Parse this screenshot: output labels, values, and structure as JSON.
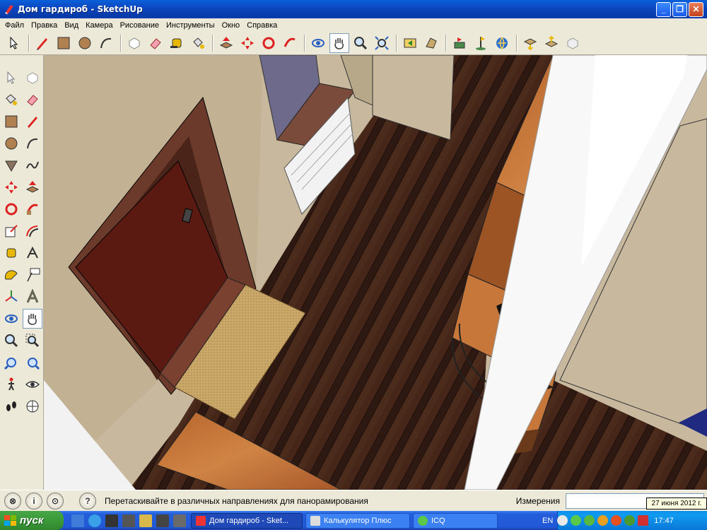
{
  "window": {
    "title": "Дом гардироб - SketchUp",
    "min_label": "_",
    "max_label": "❐",
    "close_label": "✕"
  },
  "menu": [
    "Файл",
    "Правка",
    "Вид",
    "Камера",
    "Рисование",
    "Инструменты",
    "Окно",
    "Справка"
  ],
  "toolbar_icons": [
    "select-icon",
    "pencil-icon",
    "rectangle-icon",
    "circle-icon",
    "arc-icon",
    "make-component-icon",
    "eraser-icon",
    "tape-measure-icon",
    "paint-bucket-icon",
    "push-pull-icon",
    "move-icon",
    "rotate-icon",
    "follow-me-icon",
    "orbit-icon",
    "pan-icon",
    "zoom-icon",
    "zoom-extents-icon",
    "previous-view-icon",
    "next-view-icon",
    "add-location-icon",
    "toggle-terrain-icon",
    "get-models-icon",
    "share-model-icon",
    "upload-icon",
    "download-icon",
    "get-component-icon"
  ],
  "left_tool_icons": [
    "select-icon",
    "make-component-icon",
    "paint-bucket-icon",
    "eraser-icon",
    "rectangle-icon",
    "pencil-icon",
    "circle-icon",
    "arc-icon",
    "polygon-icon",
    "freehand-icon",
    "move-icon",
    "push-pull-icon",
    "rotate-icon",
    "follow-me-icon",
    "scale-icon",
    "offset-icon",
    "tape-measure-icon",
    "dimension-icon",
    "protractor-icon",
    "text-icon",
    "axes-icon",
    "3d-text-icon",
    "orbit-icon",
    "pan-icon",
    "zoom-icon",
    "zoom-window-icon",
    "zoom-extents-icon",
    "previous-view-icon",
    "walk-icon",
    "look-around-icon",
    "footprints-icon",
    "position-camera-icon"
  ],
  "status": {
    "hint": "Перетаскивайте в различных направлениях для панорамирования",
    "measure_label": "Измерения",
    "measure_value": ""
  },
  "taskbar": {
    "start_label": "пуск",
    "tasks": [
      {
        "label": "Дом гардироб - Sket...",
        "icon": "sketchup-icon",
        "active": true
      },
      {
        "label": "Калькулятор Плюс",
        "icon": "calculator-icon",
        "active": false
      },
      {
        "label": "ICQ",
        "icon": "icq-icon",
        "active": false
      }
    ],
    "lang": "EN",
    "clock": "17:47",
    "date_tooltip": "27 июня 2012 г."
  },
  "colors": {
    "title_blue": "#0b46c0",
    "floor": "#3a2018",
    "wall": "#c7b89e",
    "door": "#5a1a12",
    "door_frame": "#6b3a2a",
    "rug": "#c9a86a",
    "wardrobe": "#c8773a",
    "taskbar_blue": "#245edb",
    "start_green": "#3c9a3a"
  }
}
